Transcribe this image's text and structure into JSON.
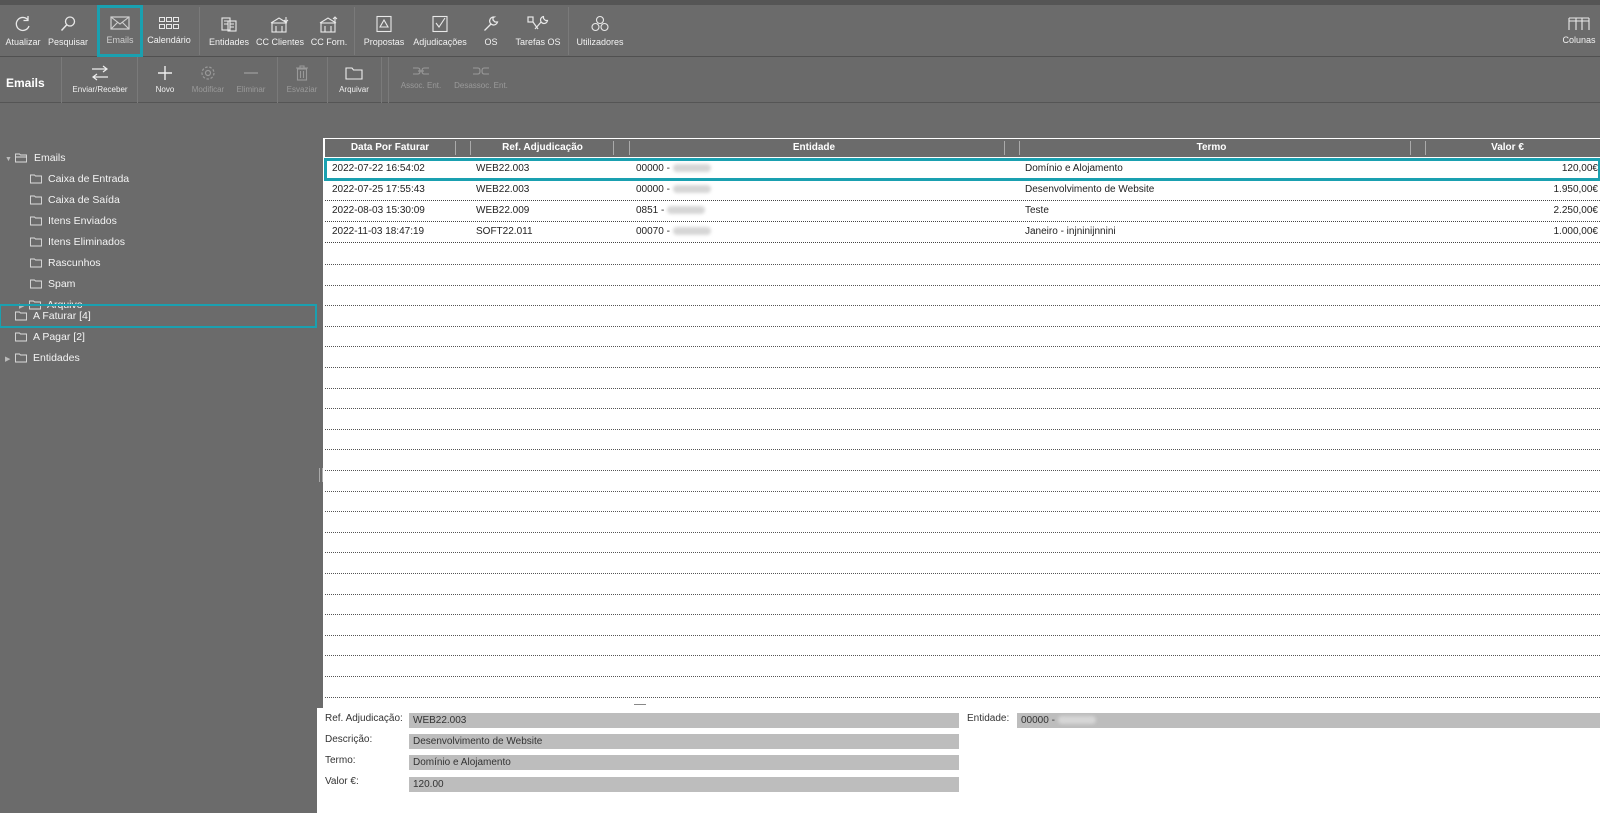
{
  "toolbar": {
    "items": [
      {
        "label": "Atualizar",
        "icon": "refresh-icon"
      },
      {
        "label": "Pesquisar",
        "icon": "search-icon"
      },
      {
        "label": "Emails",
        "icon": "envelope-icon",
        "active": true
      },
      {
        "label": "Calendário",
        "icon": "calendar-grid-icon"
      },
      {
        "label": "Entidades",
        "icon": "entities-icon"
      },
      {
        "label": "CC Clientes",
        "icon": "clients-account-icon"
      },
      {
        "label": "CC Forn.",
        "icon": "suppliers-account-icon"
      },
      {
        "label": "Propostas",
        "icon": "proposals-icon"
      },
      {
        "label": "Adjudicações",
        "icon": "check-document-icon"
      },
      {
        "label": "OS",
        "icon": "wrench-icon"
      },
      {
        "label": "Tarefas OS",
        "icon": "double-wrench-icon"
      },
      {
        "label": "Utilizadores",
        "icon": "users-icon"
      },
      {
        "label": "Colunas",
        "icon": "columns-icon"
      }
    ]
  },
  "subbar": {
    "title": "Emails",
    "items": [
      {
        "label": "Enviar/Receber",
        "icon": "send-receive-icon",
        "enabled": true
      },
      {
        "label": "Novo",
        "icon": "plus-icon",
        "enabled": true
      },
      {
        "label": "Modificar",
        "icon": "gear-icon",
        "enabled": false
      },
      {
        "label": "Eliminar",
        "icon": "minus-icon",
        "enabled": false
      },
      {
        "label": "Esvaziar",
        "icon": "trash-icon",
        "enabled": false
      },
      {
        "label": "Arquivar",
        "icon": "folder-icon",
        "enabled": true
      },
      {
        "label": "Assoc. Ent.",
        "icon": "link-icon",
        "enabled": false
      },
      {
        "label": "Desassoc. Ent.",
        "icon": "unlink-icon",
        "enabled": false
      }
    ]
  },
  "sidebar": {
    "items": [
      {
        "label": "Emails",
        "level": 0,
        "expanded": true
      },
      {
        "label": "Caixa de Entrada",
        "level": 1
      },
      {
        "label": "Caixa de Saída",
        "level": 1
      },
      {
        "label": "Itens Enviados",
        "level": 1
      },
      {
        "label": "Itens Eliminados",
        "level": 1
      },
      {
        "label": "Rascunhos",
        "level": 1
      },
      {
        "label": "Spam",
        "level": 1
      },
      {
        "label": "Arquivo",
        "level": 1,
        "collapsed": true
      },
      {
        "label": "A Faturar [4]",
        "level": 0,
        "selected": true
      },
      {
        "label": "A Pagar [2]",
        "level": 0
      },
      {
        "label": "Entidades",
        "level": 0,
        "collapsed": true
      }
    ]
  },
  "grid": {
    "columns": [
      "Data Por Faturar",
      "Ref. Adjudicação",
      "Entidade",
      "Termo",
      "Valor €"
    ],
    "rows": [
      {
        "date": "2022-07-22 16:54:02",
        "ref": "WEB22.003",
        "entity": "00000 -",
        "term": "Domínio e Alojamento",
        "value": "120,00€",
        "selected": true
      },
      {
        "date": "2022-07-25 17:55:43",
        "ref": "WEB22.003",
        "entity": "00000 -",
        "term": "Desenvolvimento de Website",
        "value": "1.950,00€"
      },
      {
        "date": "2022-08-03 15:30:09",
        "ref": "WEB22.009",
        "entity": "0851 -",
        "term": "Teste",
        "value": "2.250,00€"
      },
      {
        "date": "2022-11-03 18:47:19",
        "ref": "SOFT22.011",
        "entity": "00070 -",
        "term": "Janeiro -  injninijnnini",
        "value": "1.000,00€"
      }
    ]
  },
  "detail": {
    "ref_label": "Ref. Adjudicação:",
    "ref_value": "WEB22.003",
    "desc_label": "Descrição:",
    "desc_value": "Desenvolvimento de Website",
    "term_label": "Termo:",
    "term_value": "Domínio e Alojamento",
    "value_label": "Valor €:",
    "value_value": "120.00",
    "entity_label": "Entidade:",
    "entity_value": "00000 -"
  },
  "colors": {
    "accent": "#1aa0b0",
    "toolbar": "#6b6b6b"
  }
}
